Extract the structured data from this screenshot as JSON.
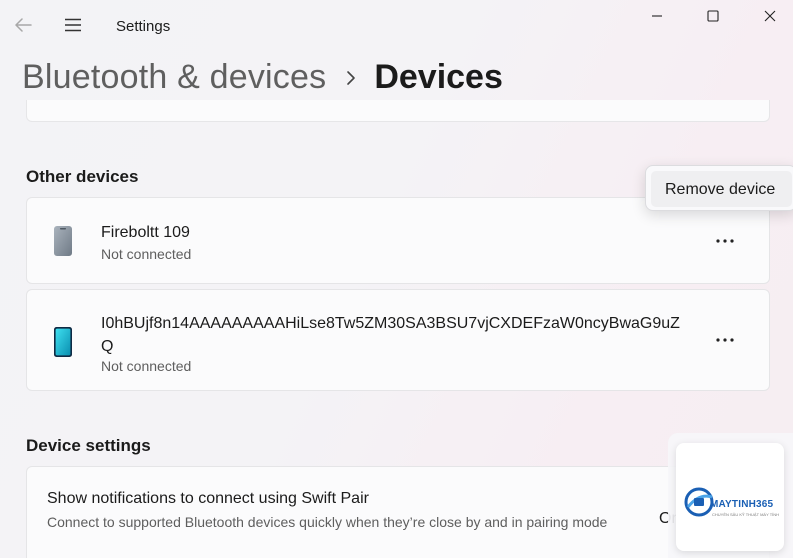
{
  "window": {
    "app_title": "Settings",
    "controls": {
      "minimize": "minimize-icon",
      "maximize": "maximize-icon",
      "close": "close-icon"
    }
  },
  "header": {
    "parent": "Bluetooth & devices",
    "separator_icon": "chevron-right-icon",
    "current": "Devices"
  },
  "other_devices": {
    "title": "Other devices",
    "devices": [
      {
        "name": "Fireboltt 109",
        "status": "Not connected",
        "icon": "phone-gray-icon"
      },
      {
        "name": "I0hBUjf8n14AAAAAAAAAHiLse8Tw5ZM30SA3BSU7vjCXDEFzaW0ncyBwaG9uZQ",
        "status": "Not connected",
        "icon": "phone-teal-icon"
      }
    ],
    "more_icon": "more-options-icon"
  },
  "context_menu": {
    "items": [
      "Remove device"
    ]
  },
  "device_settings": {
    "title": "Device settings",
    "swift_pair": {
      "title": "Show notifications to connect using Swift Pair",
      "description": "Connect to supported Bluetooth devices quickly when they’re close by and in pairing mode",
      "toggle_label": "On",
      "toggle_on": true
    }
  },
  "watermark": {
    "text": "MAYTINH365",
    "subtext": "CHUYÊN SÂU KỸ THUẬT MÁY TÍNH"
  },
  "colors": {
    "accent": "#3c6ed0",
    "card_bg": "#fbfbfc",
    "secondary_text": "#5e5e5e"
  }
}
